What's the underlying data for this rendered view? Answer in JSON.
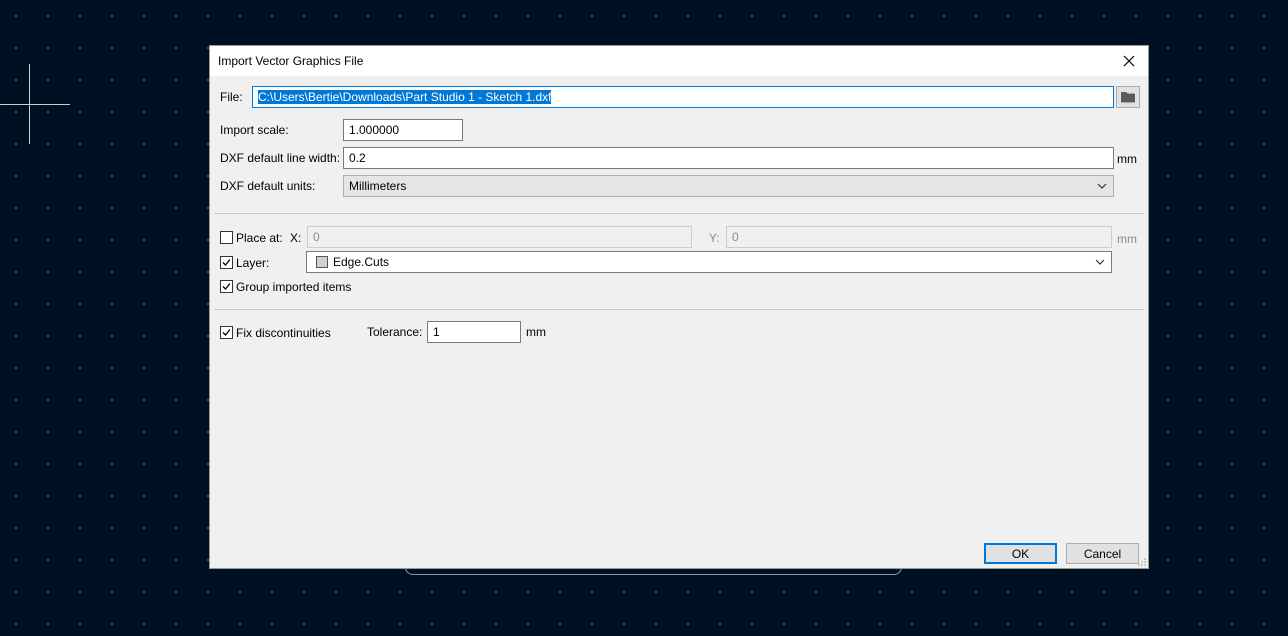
{
  "dialog": {
    "title": "Import Vector Graphics File",
    "file_label": "File:",
    "file_value": "C:\\Users\\Bertie\\Downloads\\Part Studio 1 - Sketch 1.dxf",
    "import_scale_label": "Import scale:",
    "import_scale_value": "1.000000",
    "line_width_label": "DXF default line width:",
    "line_width_value": "0.2",
    "line_width_unit": "mm",
    "units_label": "DXF default units:",
    "units_value": "Millimeters",
    "place_at_label": "Place at:",
    "place_at_checked": false,
    "x_label": "X:",
    "x_value": "0",
    "y_label": "Y:",
    "y_value": "0",
    "place_unit": "mm",
    "layer_label": "Layer:",
    "layer_checked": true,
    "layer_value": "Edge.Cuts",
    "group_label": "Group imported items",
    "group_checked": true,
    "fix_label": "Fix discontinuities",
    "fix_checked": true,
    "tolerance_label": "Tolerance:",
    "tolerance_value": "1",
    "tolerance_unit": "mm",
    "ok_label": "OK",
    "cancel_label": "Cancel"
  },
  "colors": {
    "canvas_bg": "#001023",
    "accent": "#0078d7",
    "dialog_bg": "#f0f0f0"
  }
}
